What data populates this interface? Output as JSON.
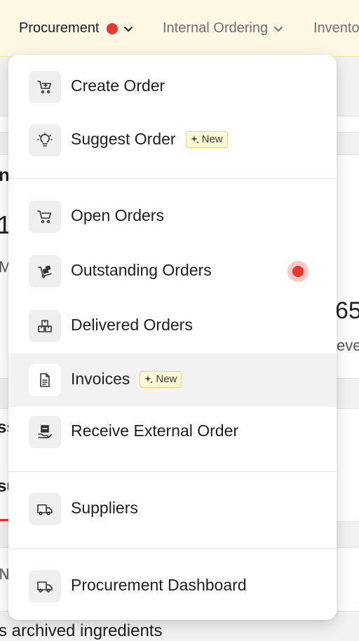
{
  "nav": {
    "procurement": "Procurement",
    "internal_ordering": "Internal Ordering",
    "inventory": "Invento"
  },
  "background": {
    "frag_1": "nt",
    "frag_2": "1:",
    "frag_3": "M",
    "frag_4": "65",
    "frag_5": "eve",
    "frag_6": "ss",
    "frag_7": "su",
    "frag_8": "N",
    "frag_9": "s archived ingredients"
  },
  "menu": {
    "create_order": "Create Order",
    "suggest_order": "Suggest Order",
    "open_orders": "Open Orders",
    "outstanding_orders": "Outstanding Orders",
    "delivered_orders": "Delivered Orders",
    "invoices": "Invoices",
    "receive_external_order": "Receive External Order",
    "suppliers": "Suppliers",
    "procurement_dashboard": "Procurement Dashboard",
    "new_badge": "New"
  },
  "colors": {
    "nav_bg": "#fdf7e3",
    "accent_red": "#e8372c",
    "badge_bg": "#fff8d6",
    "badge_border": "#f1d36a"
  }
}
